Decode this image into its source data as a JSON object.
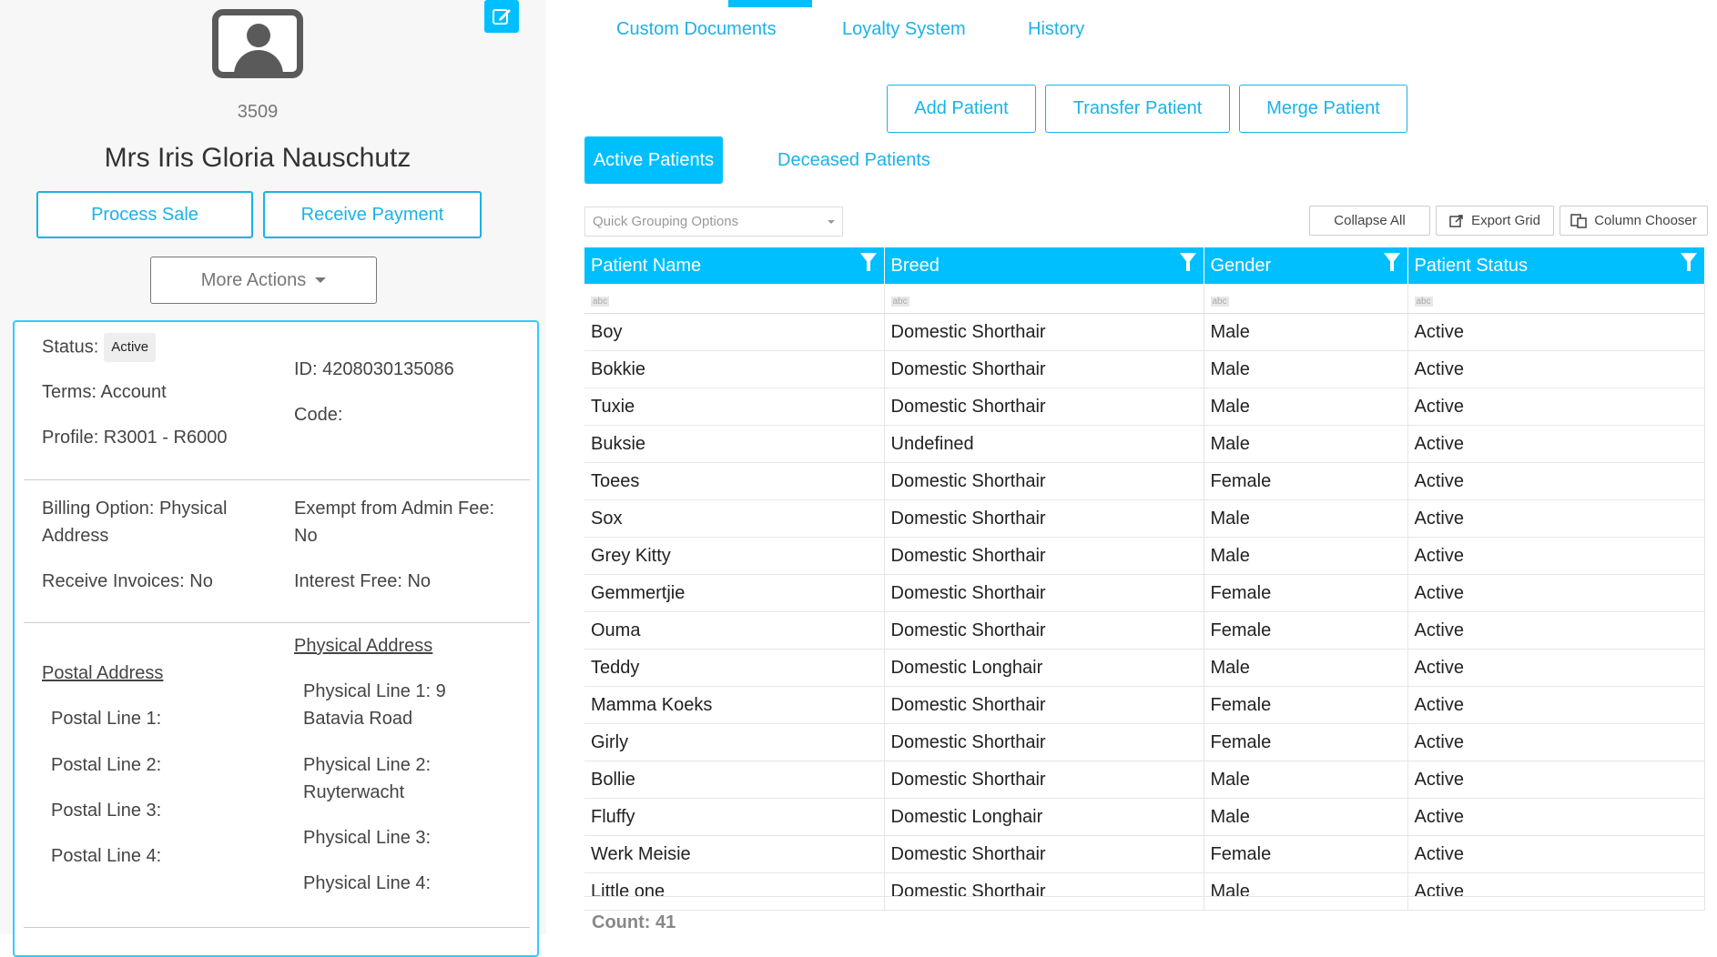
{
  "client": {
    "id_number": "3509",
    "name": "Mrs Iris Gloria Nauschutz",
    "process_sale_label": "Process Sale",
    "receive_payment_label": "Receive Payment",
    "more_actions_label": "More Actions",
    "status_label": "Status:",
    "status_value": "Active",
    "id_label": "ID: 4208030135086",
    "terms": "Terms: Account",
    "code": "Code:",
    "profile": "Profile: R3001 - R6000",
    "billing_option_line1": "Billing Option: Physical",
    "billing_option_line2": "Address",
    "exempt_line1": "Exempt from Admin Fee:",
    "exempt_line2": "No",
    "receive_invoices": "Receive Invoices: No",
    "interest_free": "Interest Free: No",
    "postal_heading": "Postal Address",
    "physical_heading": "Physical Address",
    "postal_lines": [
      "Postal Line 1:",
      "Postal Line 2:",
      "Postal Line 3:",
      "Postal Line 4:"
    ],
    "physical_line1_a": "Physical Line 1: 9",
    "physical_line1_b": "Batavia Road",
    "physical_line2_a": "Physical Line 2:",
    "physical_line2_b": "Ruyterwacht",
    "physical_line3": "Physical Line 3:",
    "physical_line4": "Physical Line 4:"
  },
  "tabs": {
    "custom_documents": "Custom Documents",
    "loyalty_system": "Loyalty System",
    "history": "History"
  },
  "patient_actions": {
    "add": "Add Patient",
    "transfer": "Transfer Patient",
    "merge": "Merge Patient"
  },
  "patient_tabs": {
    "active": "Active Patients",
    "deceased": "Deceased Patients"
  },
  "toolbar": {
    "grouping_placeholder": "Quick Grouping Options",
    "collapse_all": "Collapse All",
    "export_grid": "Export Grid",
    "column_chooser": "Column Chooser"
  },
  "grid": {
    "columns": [
      "Patient Name",
      "Breed",
      "Gender",
      "Patient Status"
    ],
    "filter_hint": "abc",
    "rows": [
      [
        "Boy",
        "Domestic Shorthair",
        "Male",
        "Active"
      ],
      [
        "Bokkie",
        "Domestic Shorthair",
        "Male",
        "Active"
      ],
      [
        "Tuxie",
        "Domestic Shorthair",
        "Male",
        "Active"
      ],
      [
        "Buksie",
        "Undefined",
        "Male",
        "Active"
      ],
      [
        "Toees",
        "Domestic Shorthair",
        "Female",
        "Active"
      ],
      [
        "Sox",
        "Domestic Shorthair",
        "Male",
        "Active"
      ],
      [
        "Grey Kitty",
        "Domestic Shorthair",
        "Male",
        "Active"
      ],
      [
        "Gemmertjie",
        "Domestic Shorthair",
        "Female",
        "Active"
      ],
      [
        "Ouma",
        "Domestic Shorthair",
        "Female",
        "Active"
      ],
      [
        "Teddy",
        "Domestic Longhair",
        "Male",
        "Active"
      ],
      [
        "Mamma Koeks",
        "Domestic Shorthair",
        "Female",
        "Active"
      ],
      [
        "Girly",
        "Domestic Shorthair",
        "Female",
        "Active"
      ],
      [
        "Bollie",
        "Domestic Shorthair",
        "Male",
        "Active"
      ],
      [
        "Fluffy",
        "Domestic Longhair",
        "Male",
        "Active"
      ],
      [
        "Werk Meisie",
        "Domestic Shorthair",
        "Female",
        "Active"
      ],
      [
        "Little one",
        "Domestic Shorthair",
        "Male",
        "Active"
      ]
    ],
    "count": "Count: 41"
  }
}
